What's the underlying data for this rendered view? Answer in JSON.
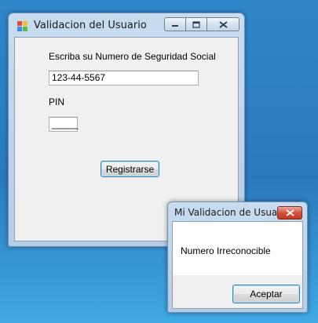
{
  "window": {
    "title": "Validacion del Usuario",
    "ssn_label": "Escriba su Numero de Seguridad Social",
    "ssn_value": "123-44-5567",
    "pin_label": "PIN",
    "pin_value": "_____",
    "register_label": "Registrarse",
    "icons": [
      "app-icon",
      "minimize-icon",
      "maximize-icon",
      "close-icon"
    ]
  },
  "dialog": {
    "title": "Mi Validacion de Usuario",
    "message": "Numero Irreconocible",
    "ok_label": "Aceptar",
    "icons": [
      "close-icon"
    ]
  },
  "colors": {
    "desktop": "#2b78bd",
    "close_button": "#c13a22",
    "focus_border": "#3c7fb1"
  }
}
